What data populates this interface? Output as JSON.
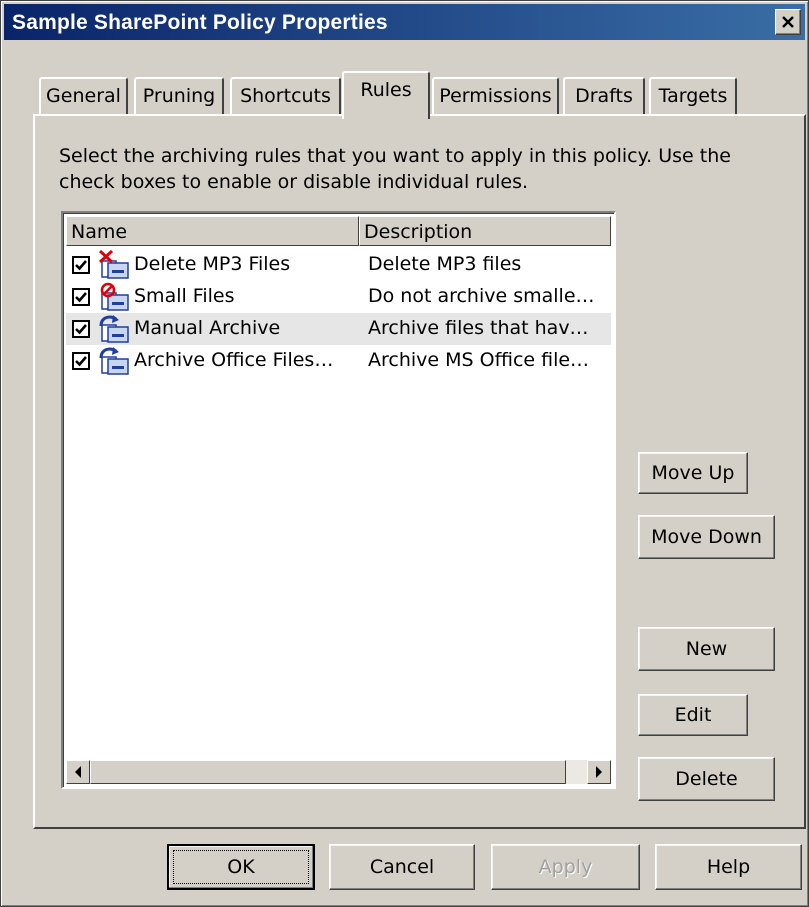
{
  "window": {
    "title": "Sample SharePoint Policy Properties"
  },
  "tabs": [
    {
      "label": "General"
    },
    {
      "label": "Pruning"
    },
    {
      "label": "Shortcuts"
    },
    {
      "label": "Rules",
      "active": true
    },
    {
      "label": "Permissions"
    },
    {
      "label": "Drafts"
    },
    {
      "label": "Targets"
    }
  ],
  "rules_panel": {
    "instructions": "Select the archiving rules that you want to apply in this policy. Use the check boxes to enable or disable individual rules.",
    "columns": {
      "name": "Name",
      "description": "Description"
    },
    "rules": [
      {
        "name": "Delete MP3 Files",
        "description": "Delete MP3 files",
        "checked": true,
        "icon": "delete-rule-icon"
      },
      {
        "name": "Small Files",
        "description": "Do not archive smalle…",
        "checked": true,
        "icon": "exclude-rule-icon"
      },
      {
        "name": "Manual Archive",
        "description": "Archive files that hav…",
        "checked": true,
        "icon": "archive-rule-icon"
      },
      {
        "name": "Archive Office Files…",
        "description": "Archive MS Office file…",
        "checked": true,
        "icon": "archive-rule-icon"
      }
    ],
    "buttons": {
      "move_up": "Move Up",
      "move_down": "Move Down",
      "new": "New",
      "edit": "Edit",
      "delete": "Delete"
    }
  },
  "footer": {
    "ok": "OK",
    "cancel": "Cancel",
    "apply": "Apply",
    "help": "Help"
  },
  "colors": {
    "dialog_face": "#d4d0c8",
    "title_gradient_start": "#0a246a",
    "title_gradient_end": "#3a6ea5",
    "delete_icon_red": "#e0000d",
    "archive_arrow_blue": "#1f3fa0"
  }
}
